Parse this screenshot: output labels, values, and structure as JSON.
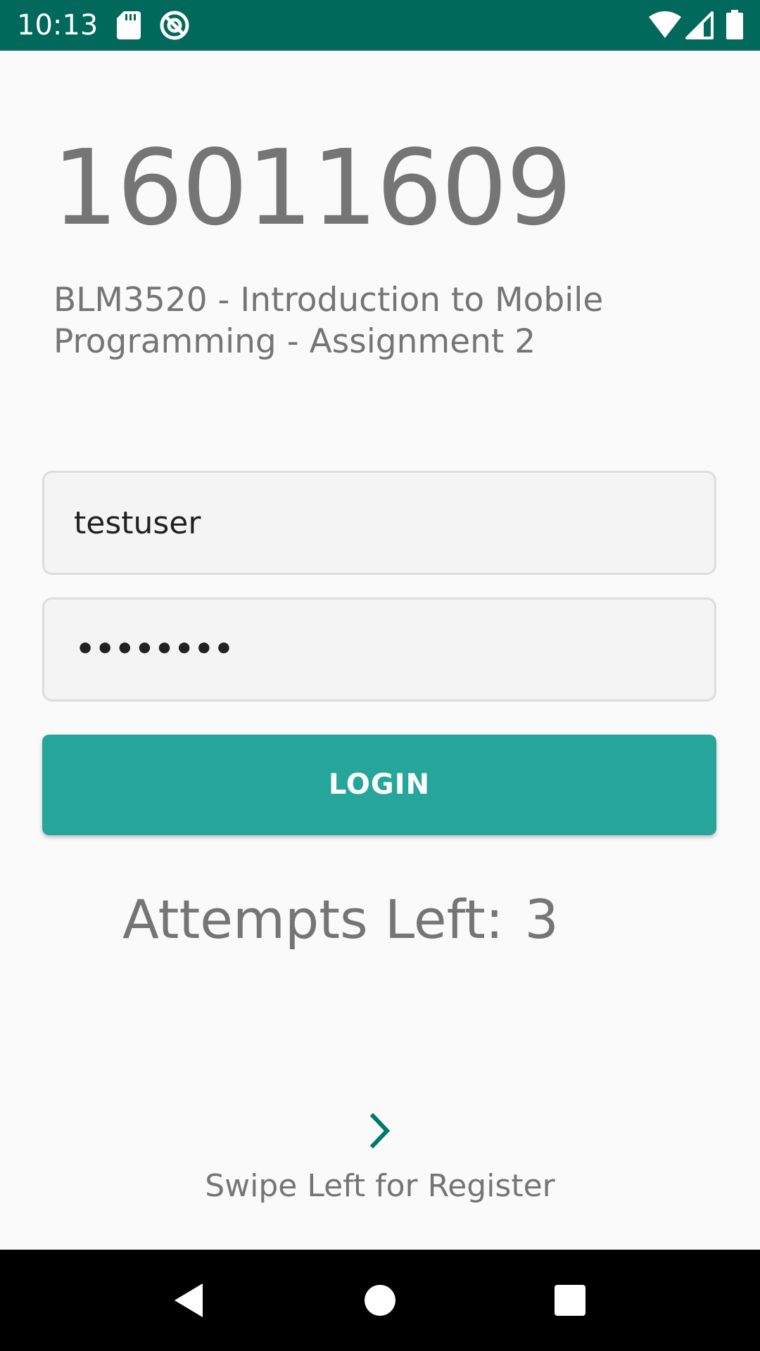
{
  "status_bar": {
    "time": "10:13",
    "background_color": "#00695c",
    "icons": [
      "sd-card-icon",
      "sync-icon",
      "wifi-icon",
      "signal-icon",
      "battery-icon"
    ]
  },
  "header": {
    "student_id": "16011609",
    "course_title": "BLM3520 - Introduction to Mobile Programming - Assignment 2"
  },
  "form": {
    "username_value": "testuser",
    "password_display": "••••••••",
    "login_label": "LOGIN",
    "accent_color": "#26a69a"
  },
  "attempts": {
    "label": "Attempts Left:",
    "value": "3"
  },
  "footer": {
    "swipe_icon": "chevron-right-icon",
    "swipe_label": "Swipe Left for Register"
  },
  "nav_bar": {
    "buttons": [
      "back-icon",
      "home-icon",
      "recents-icon"
    ]
  }
}
